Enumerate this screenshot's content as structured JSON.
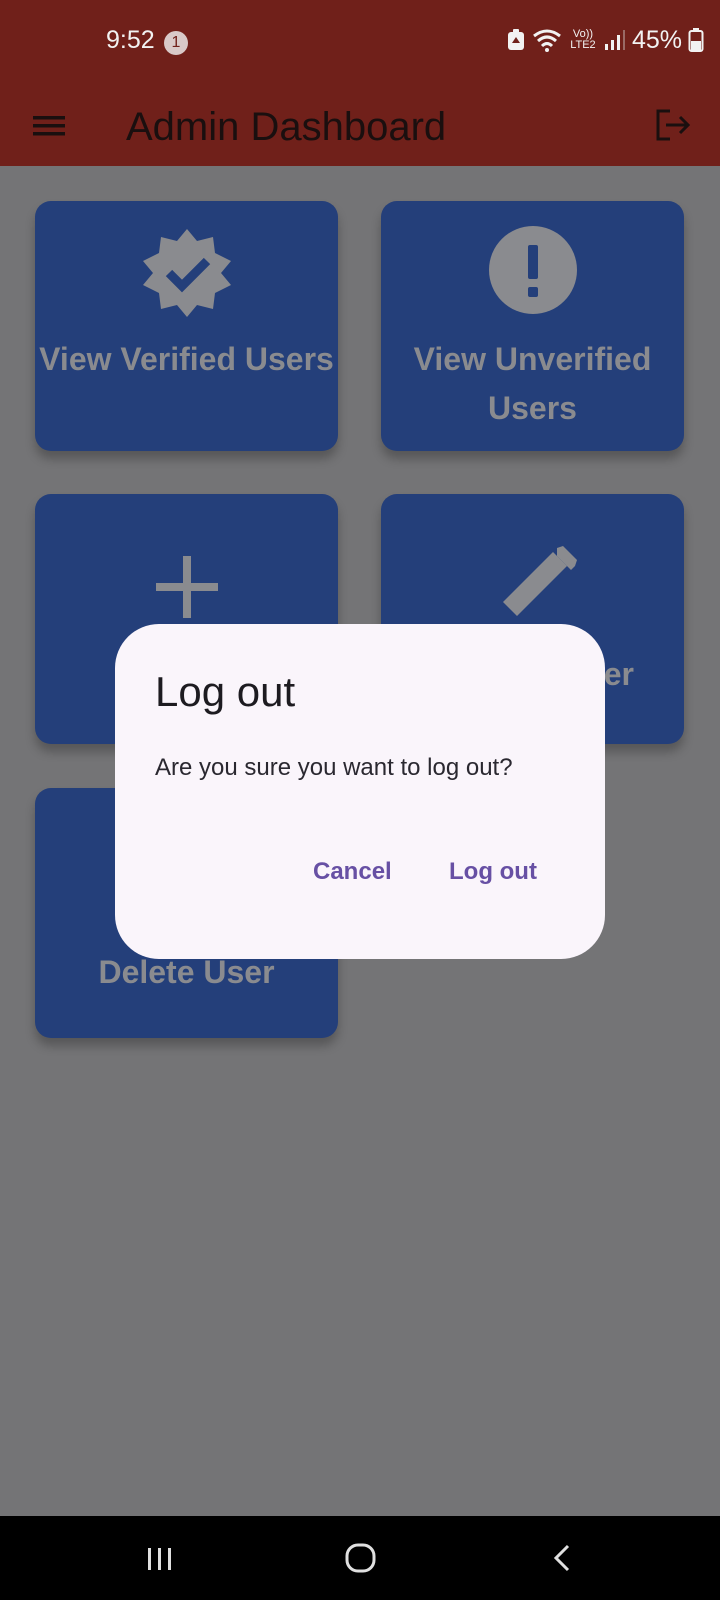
{
  "status_bar": {
    "time": "9:52",
    "notification_count": "1",
    "network_label": "Vo)) LTE2",
    "battery_percent": "45%"
  },
  "app_bar": {
    "title": "Admin Dashboard",
    "icons": [
      "menu-icon",
      "logout-icon"
    ]
  },
  "cards": [
    {
      "label": "View Verified Users",
      "icon": "verified-badge-icon"
    },
    {
      "label": "View Unverified Users",
      "icon": "alert-circle-icon"
    },
    {
      "label": "",
      "icon": "plus-icon"
    },
    {
      "label": "er",
      "icon": "pencil-icon"
    },
    {
      "label": "Delete User",
      "icon": ""
    }
  ],
  "dialog": {
    "title": "Log out",
    "message": "Are you sure you want to log out?",
    "cancel_label": "Cancel",
    "confirm_label": "Log out"
  },
  "colors": {
    "app_bar": "#70201a",
    "card": "#243f7a",
    "scrim_background": "#747476",
    "dialog_background": "#faf5fb",
    "dialog_button": "#6750a4"
  }
}
